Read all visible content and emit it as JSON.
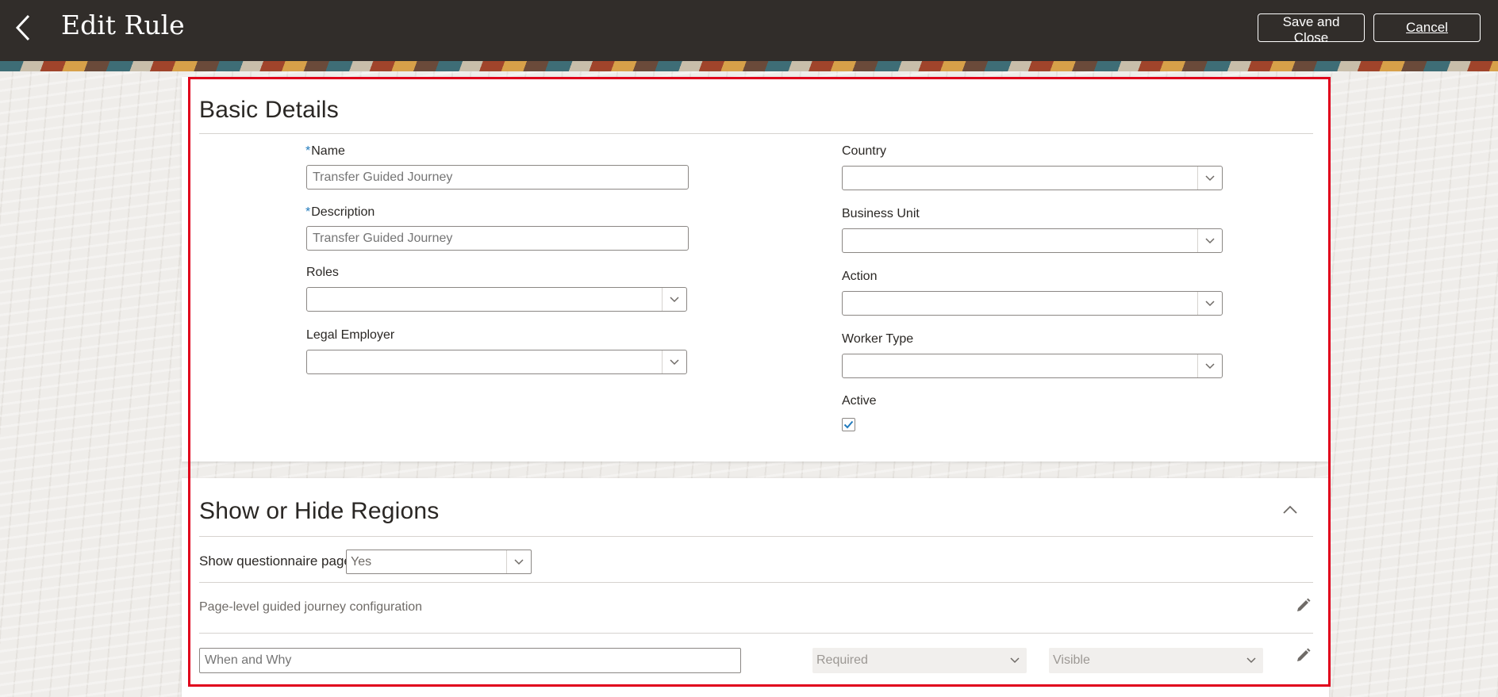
{
  "header": {
    "title": "Edit Rule",
    "save_close_label": "Save and Close",
    "cancel_label": "Cancel",
    "back_icon": "chevron-left-icon"
  },
  "basic_details": {
    "title": "Basic Details",
    "name": {
      "label": "Name",
      "required_marker": "*",
      "placeholder": "Transfer Guided Journey"
    },
    "description": {
      "label": "Description",
      "required_marker": "*",
      "placeholder": "Transfer Guided Journey"
    },
    "roles": {
      "label": "Roles",
      "value": ""
    },
    "legal_employer": {
      "label": "Legal Employer",
      "value": ""
    },
    "country": {
      "label": "Country",
      "value": ""
    },
    "business_unit": {
      "label": "Business Unit",
      "value": ""
    },
    "action": {
      "label": "Action",
      "value": ""
    },
    "worker_type": {
      "label": "Worker Type",
      "value": ""
    },
    "active": {
      "label": "Active",
      "checked": true
    }
  },
  "show_hide_regions": {
    "title": "Show or Hide Regions",
    "questionnaire_label": "Show questionnaire page",
    "questionnaire_value": "Yes",
    "config_text": "Page-level guided journey configuration",
    "row": {
      "region_placeholder": "When and Why",
      "required_value": "Required",
      "visible_value": "Visible"
    }
  },
  "colors": {
    "header_bg": "#312d2a",
    "highlight": "#e0001b",
    "required_marker": "#227bbd",
    "checkbox_check": "#227bbd"
  }
}
